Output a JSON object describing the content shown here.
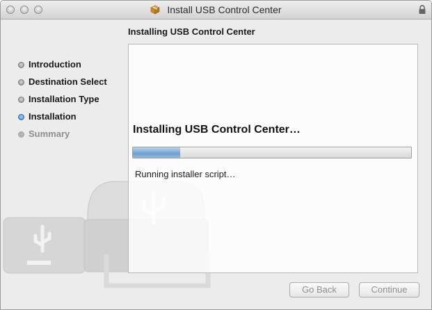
{
  "window": {
    "title": "Install USB Control Center",
    "title_icon": "package-icon",
    "lock_icon": "lock-icon"
  },
  "header": {
    "subtitle": "Installing USB Control Center"
  },
  "sidebar": {
    "steps": [
      {
        "label": "Introduction",
        "state": "done"
      },
      {
        "label": "Destination Select",
        "state": "done"
      },
      {
        "label": "Installation Type",
        "state": "done"
      },
      {
        "label": "Installation",
        "state": "active"
      },
      {
        "label": "Summary",
        "state": "pending"
      }
    ]
  },
  "main": {
    "status_title": "Installing USB Control Center…",
    "progress": 0.17,
    "status_message": "Running installer script…"
  },
  "buttons": {
    "go_back": "Go Back",
    "continue": "Continue"
  },
  "colors": {
    "active_step": "#3d87d6",
    "progress_fill": "#6e9fd0"
  }
}
